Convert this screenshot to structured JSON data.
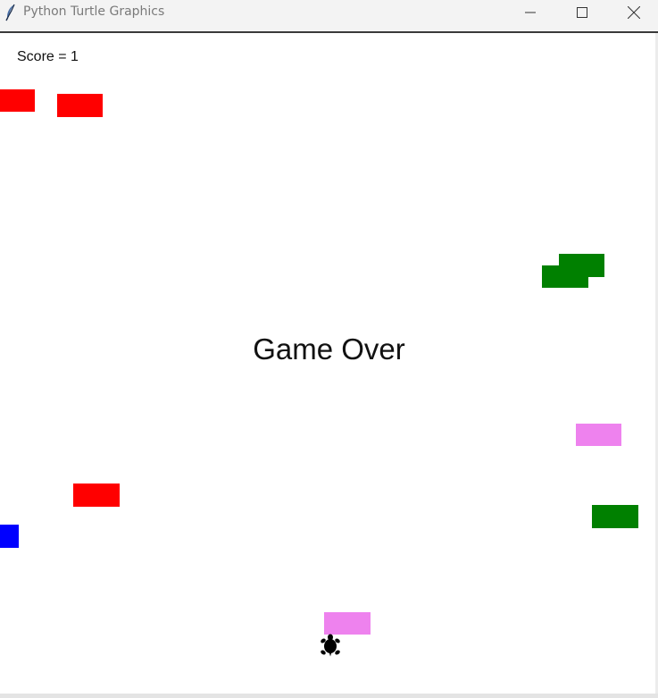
{
  "window": {
    "title": "Python Turtle Graphics",
    "icon": "feather-icon",
    "controls": [
      "minimize-icon",
      "maximize-icon",
      "close-icon"
    ]
  },
  "game": {
    "score_text": "Score = 1",
    "status_text": "Game Over",
    "colors": {
      "red": "#ff0000",
      "green": "#008000",
      "violet": "#ee82ee",
      "blue": "#0000ff",
      "player": "#000000"
    },
    "player": {
      "shape": "turtle-icon"
    }
  }
}
